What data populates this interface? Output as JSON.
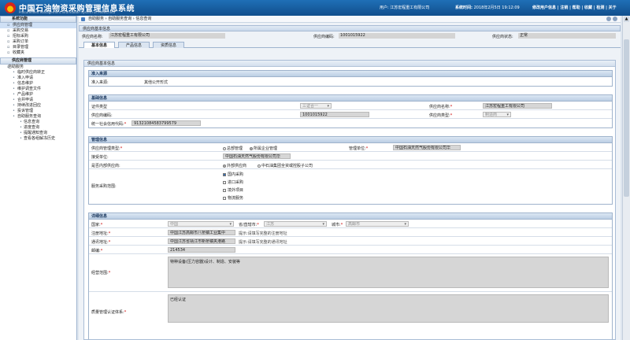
{
  "header": {
    "title": "中国石油物资采购管理信息系统",
    "subtitle": "Procurement Management Information System of PetroChina",
    "user_label": "用户:",
    "user_value": "江苏宏程重工有限公司",
    "time_label": "系统时间:",
    "time_value": "2018年2月5日 19:12:09",
    "links": [
      "修改用户信息",
      "注销",
      "帮助",
      "收藏",
      "检测",
      "关于"
    ]
  },
  "sidebar": {
    "system_head": "系统功能",
    "system_items": [
      "供应商管理",
      "采购交易",
      "招标采购",
      "采购订单",
      "目录管理",
      "收藏夹"
    ],
    "supplier_head": "供应商管理",
    "self_service": "自助服务",
    "self_items": [
      "临时供应商转正",
      "准入申请",
      "信息维护",
      "维护调查文件",
      "产品维护",
      "合并申请",
      "持续改进回应",
      "投诉管理"
    ],
    "query_group": "自助服务查询",
    "query_items": [
      "信息查询",
      "进度查询",
      "提醒通知查询",
      "查看各组解冻历史"
    ]
  },
  "breadcrumb": "自助服务 › 自助服务查询 › 信息查询",
  "panel": {
    "title": "供应商基本信息",
    "name_label": "供应商名称:",
    "name_value": "江苏宏程重工有限公司",
    "code_label": "供应商编码:",
    "code_value": "1001015922",
    "status_label": "供应商状态:",
    "status_value": "正常"
  },
  "tabs": [
    "基本信息",
    "产品信息",
    "资质信息"
  ],
  "content_title": "供应商基本信息",
  "access": {
    "head": "准入来源",
    "label": "准入来源:",
    "value": "其他公开形式"
  },
  "basic": {
    "head": "基础信息",
    "cert_type_label": "证件类型",
    "cert_type_value": "三证合一",
    "supplier_name_label": "供应商名称:",
    "supplier_name_value": "江苏宏程重工有限公司",
    "code_label": "供应商编码:",
    "code_value": "1001015922",
    "type_label": "供应商类型:",
    "type_value": "制造商",
    "credit_label": "统一社会信用代码:",
    "credit_value": "91321084583799579"
  },
  "mgmt": {
    "head": "管理信息",
    "type_label": "供应商管理类型:",
    "radio1": "总部管理",
    "radio2": "所属企业管理",
    "unit_label": "管理单位:",
    "unit_value": "中国石油天然气股份有限公司华",
    "receive_label": "接受单位:",
    "receive_value": "中国石油天然气股份有限公司华",
    "internal_label": "是否内部供应商:",
    "internal_r1": "外部供应商",
    "internal_r2": "中石油集团全资或控股子公司",
    "scope_label": "服务采购范围:",
    "scope_items": [
      "国内采购",
      "进口采购",
      "境外项目",
      "物流服务"
    ]
  },
  "detail": {
    "head": "详细信息",
    "country_label": "国家:",
    "country_value": "中国",
    "province_label": "省/直辖市:",
    "province_value": "江苏",
    "city_label": "城市:",
    "city_value": "高邮市",
    "reg_addr_label": "注册地址:",
    "reg_addr_value": "中国江苏高邮市八桥镇工业集中",
    "reg_addr_hint": "提示:请填写完整的注册地址",
    "mail_addr_label": "通讯地址:",
    "mail_addr_value": "中国江苏省靖江市新桥镇夹港路",
    "mail_addr_hint": "提示:请填写完整的通讯地址",
    "zip_label": "邮编:",
    "zip_value": "214534",
    "business_label": "经营范围:",
    "business_value": "特种设备(压力容器)设计、制造、安装等",
    "quality_label": "质量管理认证体系:",
    "quality_value": "已经认证"
  }
}
